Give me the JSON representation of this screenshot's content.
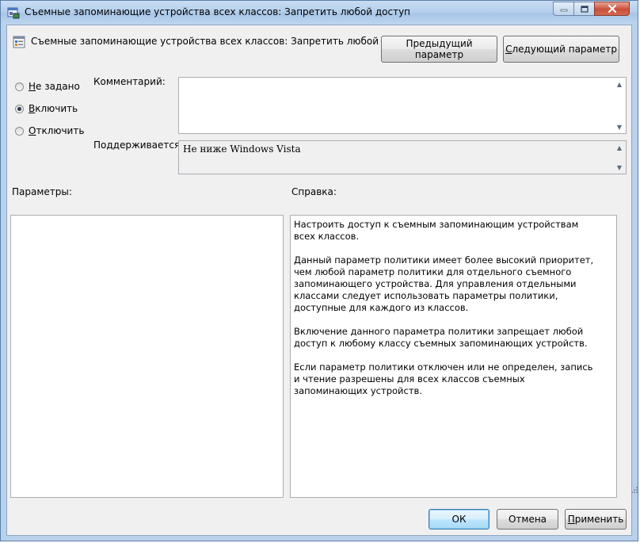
{
  "window": {
    "title": "Съемные запоминающие устройства всех классов: Запретить любой доступ"
  },
  "header": {
    "policy_name": "Съемные запоминающие устройства всех классов: Запретить любой доступ",
    "prev_button": {
      "accel": "Пре",
      "accel_char": "д",
      "rest": "ыдущий параметр"
    },
    "next_button": {
      "accel": "",
      "accel_char": "С",
      "rest": "ледующий параметр"
    }
  },
  "state": {
    "options": [
      {
        "accel_char": "Н",
        "rest": "е задано",
        "checked": false
      },
      {
        "accel_char": "В",
        "rest": "ключить",
        "checked": true
      },
      {
        "accel_char": "О",
        "rest": "тключить",
        "checked": false
      }
    ]
  },
  "comment": {
    "label": "Комментарий:",
    "value": ""
  },
  "supported": {
    "label": "Поддерживается:",
    "value": "Не ниже Windows Vista"
  },
  "params": {
    "label": "Параметры:"
  },
  "help": {
    "label": "Справка:",
    "paragraphs": [
      "Настроить доступ к съемным запоминающим устройствам всех классов.",
      "Данный параметр политики имеет более высокий приоритет, чем любой параметр политики для отдельного съемного запоминающего устройства. Для управления отдельными классами следует использовать параметры политики, доступные для каждого из классов.",
      "Включение данного параметра политики запрещает любой доступ к любому классу съемных запоминающих устройств.",
      "Если параметр политики отключен или не определен, запись и чтение разрешены для всех классов съемных запоминающих устройств."
    ]
  },
  "footer": {
    "ok": "ОК",
    "cancel": "Отмена",
    "apply": {
      "accel_char": "П",
      "rest": "рименить"
    }
  },
  "colors": {
    "title_bar": "#b5cfec",
    "client_bg": "#f0f0f0",
    "default_button_border": "#3c7fb1"
  }
}
